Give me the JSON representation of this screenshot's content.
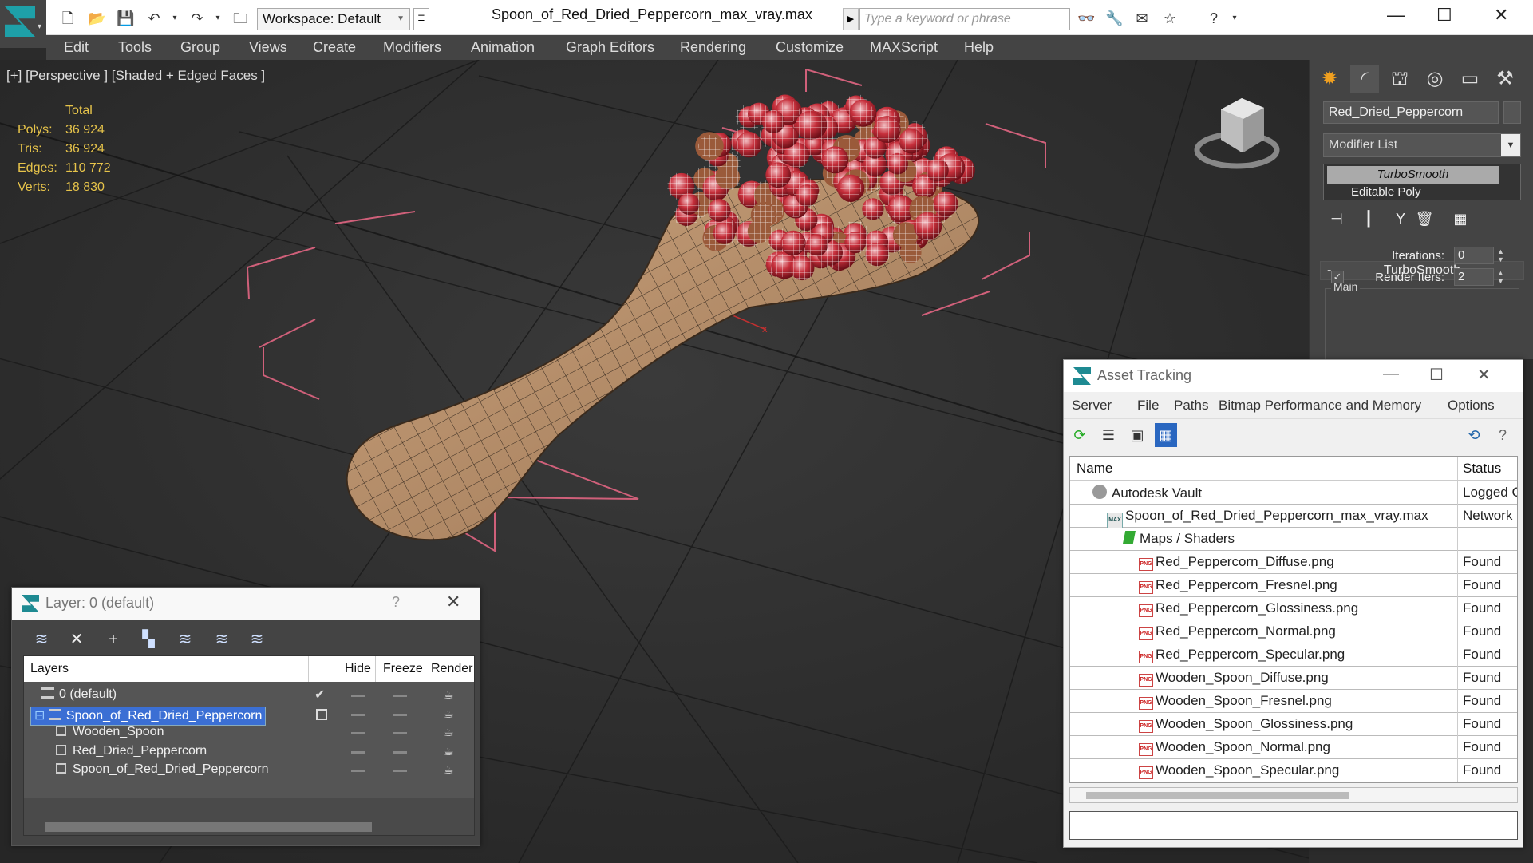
{
  "titlebar": {
    "workspace": "Workspace: Default",
    "document_title": "Spoon_of_Red_Dried_Peppercorn_max_vray.max",
    "search_placeholder": "Type a keyword or phrase"
  },
  "menu": [
    "Edit",
    "Tools",
    "Group",
    "Views",
    "Create",
    "Modifiers",
    "Animation",
    "Graph Editors",
    "Rendering",
    "Customize",
    "MAXScript",
    "Help"
  ],
  "viewport": {
    "label": "[+] [Perspective ] [Shaded + Edged Faces ]",
    "stats_header": "Total",
    "stats": [
      {
        "k": "Polys:",
        "v": "36 924"
      },
      {
        "k": "Tris:",
        "v": "36 924"
      },
      {
        "k": "Edges:",
        "v": "110 772"
      },
      {
        "k": "Verts:",
        "v": "18 830"
      }
    ]
  },
  "command_panel": {
    "object_name": "Red_Dried_Peppercorn",
    "modifier_list": "Modifier List",
    "stack": [
      "TurboSmooth",
      "Editable Poly"
    ],
    "rollout_title": "TurboSmooth",
    "group_label": "Main",
    "iterations_label": "Iterations:",
    "iterations_value": "0",
    "render_iters_label": "Render Iters:",
    "render_iters_value": "2",
    "render_iters_checked": "✓"
  },
  "asset_tracking": {
    "title": "Asset Tracking",
    "menu": [
      "Server",
      "File",
      "Paths",
      "Bitmap Performance and Memory",
      "Options"
    ],
    "col_name": "Name",
    "col_status": "Status",
    "rows": [
      {
        "name": "Autodesk Vault",
        "status": "Logged C"
      },
      {
        "name": "Spoon_of_Red_Dried_Peppercorn_max_vray.max",
        "status": "Network"
      },
      {
        "name": "Maps / Shaders",
        "status": ""
      },
      {
        "name": "Red_Peppercorn_Diffuse.png",
        "status": "Found"
      },
      {
        "name": "Red_Peppercorn_Fresnel.png",
        "status": "Found"
      },
      {
        "name": "Red_Peppercorn_Glossiness.png",
        "status": "Found"
      },
      {
        "name": "Red_Peppercorn_Normal.png",
        "status": "Found"
      },
      {
        "name": "Red_Peppercorn_Specular.png",
        "status": "Found"
      },
      {
        "name": "Wooden_Spoon_Diffuse.png",
        "status": "Found"
      },
      {
        "name": "Wooden_Spoon_Fresnel.png",
        "status": "Found"
      },
      {
        "name": "Wooden_Spoon_Glossiness.png",
        "status": "Found"
      },
      {
        "name": "Wooden_Spoon_Normal.png",
        "status": "Found"
      },
      {
        "name": "Wooden_Spoon_Specular.png",
        "status": "Found"
      }
    ]
  },
  "layer_window": {
    "title": "Layer: 0 (default)",
    "help": "?",
    "col_layers": "Layers",
    "col_hide": "Hide",
    "col_freeze": "Freeze",
    "col_render": "Render",
    "rows": [
      {
        "name": "0 (default)"
      },
      {
        "name": "Spoon_of_Red_Dried_Peppercorn"
      },
      {
        "name": "Wooden_Spoon"
      },
      {
        "name": "Red_Dried_Peppercorn"
      },
      {
        "name": "Spoon_of_Red_Dried_Peppercorn"
      }
    ]
  },
  "colors": {
    "accent": "#1ea0a8",
    "selection": "#3b6fd4",
    "stats_text": "#e6c34a",
    "wood": "#b08a68",
    "peppercorn": "#c0303a"
  }
}
